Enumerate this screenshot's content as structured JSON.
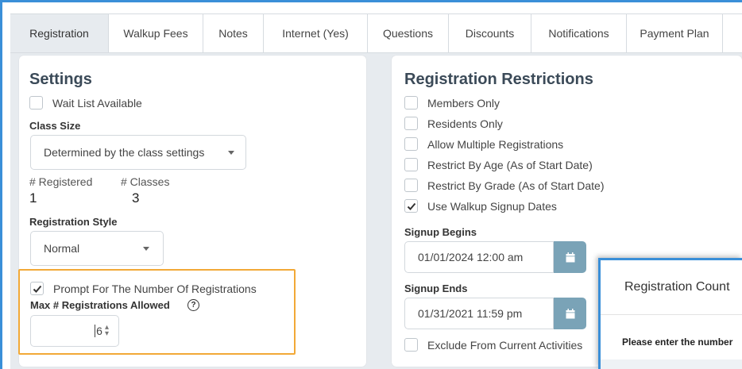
{
  "tabs": [
    {
      "label": "Registration",
      "active": true
    },
    {
      "label": "Walkup Fees"
    },
    {
      "label": "Notes"
    },
    {
      "label": "Internet (Yes)"
    },
    {
      "label": "Questions"
    },
    {
      "label": "Discounts"
    },
    {
      "label": "Notifications"
    },
    {
      "label": "Payment Plan"
    }
  ],
  "settings": {
    "title": "Settings",
    "wait_list": {
      "label": "Wait List Available",
      "checked": false
    },
    "class_size_label": "Class Size",
    "class_size_value": "Determined by the class settings",
    "registered_label": "# Registered",
    "registered_value": "1",
    "classes_label": "# Classes",
    "classes_value": "3",
    "registration_style_label": "Registration Style",
    "registration_style_value": "Normal",
    "prompt_number": {
      "label": "Prompt For The Number Of Registrations",
      "checked": true
    },
    "max_label": "Max # Registrations Allowed",
    "help_glyph": "?",
    "max_value": "6"
  },
  "restrictions": {
    "title": "Registration Restrictions",
    "items": [
      {
        "label": "Members Only",
        "checked": false
      },
      {
        "label": "Residents Only",
        "checked": false
      },
      {
        "label": "Allow Multiple Registrations",
        "checked": false
      },
      {
        "label": "Restrict By Age (As of Start Date)",
        "checked": false
      },
      {
        "label": "Restrict By Grade (As of Start Date)",
        "checked": false
      },
      {
        "label": "Use Walkup Signup Dates",
        "checked": true
      }
    ],
    "signup_begins_label": "Signup Begins",
    "signup_begins_value": "01/01/2024 12:00 am",
    "signup_ends_label": "Signup Ends",
    "signup_ends_value": "01/31/2021 11:59 pm",
    "exclude": {
      "label": "Exclude From Current Activities",
      "checked": false
    }
  },
  "dialog": {
    "title": "Registration Count",
    "text": "Please enter the number"
  },
  "colors": {
    "accent_blue": "#3a8fd8",
    "highlight_orange": "#f2a937",
    "calendar_button": "#7aa3b7",
    "workspace_bg": "#e7ebef"
  }
}
